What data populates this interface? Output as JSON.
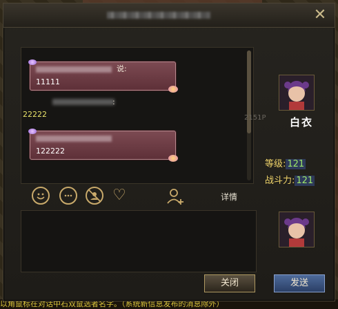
{
  "dialog": {
    "close_glyph": "✕"
  },
  "chat": {
    "messages": [
      {
        "said": "说:",
        "text": "11111",
        "style": "bubble"
      },
      {
        "said": ":",
        "text": "22222",
        "style": "plain"
      },
      {
        "text": "122222",
        "style": "bubble"
      }
    ]
  },
  "toolbar": {
    "emoji_icon": "smile-icon",
    "chat_icon": "speech-bubble-icon",
    "block_icon": "block-user-icon",
    "heart_icon": "heart-icon",
    "add_friend_icon": "add-friend-icon",
    "details_label": "详情"
  },
  "target": {
    "name": "白衣",
    "faded_id": "2151P",
    "level_label": "等级:",
    "level_value": "121",
    "power_label": "战斗力:",
    "power_value": "121"
  },
  "buttons": {
    "close_label": "关闭",
    "send_label": "发送"
  },
  "bottom_strip": {
    "text": "以角鼠标在对话中石双鼠选者名字。（系统新信息发布的消息除外）"
  },
  "colors": {
    "accent_gold": "#c9aa6b",
    "stat_label": "#f0d46a",
    "stat_value": "#9fe86a",
    "bubble": "#7c4a52",
    "send_button": "#4d6a9a"
  }
}
